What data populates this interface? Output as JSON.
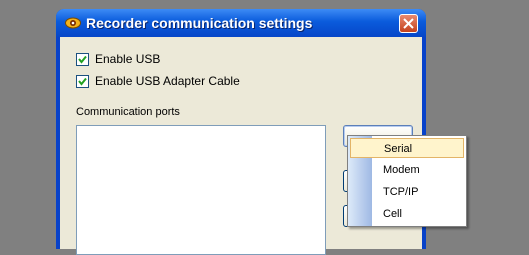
{
  "window": {
    "title": "Recorder communication settings"
  },
  "options": {
    "enable_usb": {
      "label": "Enable USB",
      "checked": true
    },
    "enable_usb_adapter_cable": {
      "label": "Enable USB Adapter Cable",
      "checked": true
    }
  },
  "ports": {
    "label": "Communication ports",
    "items": []
  },
  "add_menu": {
    "items": [
      {
        "label": "Serial",
        "selected": true
      },
      {
        "label": "Modem",
        "selected": false
      },
      {
        "label": "TCP/IP",
        "selected": false
      },
      {
        "label": "Cell",
        "selected": false
      }
    ]
  },
  "icons": [
    "app-icon",
    "close-icon",
    "checkmark-icon"
  ],
  "colors": {
    "titlebar": "#0a5bdc",
    "client": "#ece9d8",
    "menu_highlight": "#fff4cc"
  }
}
